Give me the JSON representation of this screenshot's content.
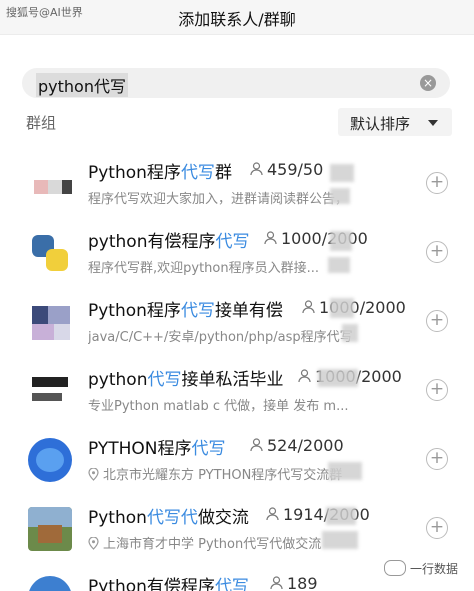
{
  "header": {
    "watermark": "搜狐号@AI世界",
    "title": "添加联系人/群聊"
  },
  "search": {
    "value": "python代写",
    "clear_icon": "clear-icon"
  },
  "filter": {
    "label": "群组",
    "sort_label": "默认排序"
  },
  "groups": [
    {
      "name_prefix": "Python程序",
      "name_highlight": "代写",
      "name_suffix": "群",
      "members": "459/50",
      "desc": "程序代写欢迎大家加入，进群请阅读群公告，"
    },
    {
      "name_prefix": "python有偿程序",
      "name_highlight": "代写",
      "name_suffix": "",
      "members": "1000/2000",
      "desc": "程序代写群,欢迎python程序员入群接..."
    },
    {
      "name_prefix": "Python程序",
      "name_highlight": "代写",
      "name_suffix": "接单有偿",
      "members": "1000/2000",
      "desc": "java/C/C++/安卓/python/php/asp程序代写"
    },
    {
      "name_prefix": "python",
      "name_highlight": "代写",
      "name_suffix": "接单私活毕业",
      "members": "1000/2000",
      "desc": "专业Python matlab c 代做，接单 发布 m..."
    },
    {
      "name_prefix": "PYTHON程序",
      "name_highlight": "代写",
      "name_suffix": "",
      "members": "524/2000",
      "desc": "北京市光耀东方 PYTHON程序代写交流群"
    },
    {
      "name_prefix": "Python",
      "name_highlight": "代写代",
      "name_suffix": "做交流",
      "members": "1914/2000",
      "desc": "上海市育才中学 Python代写代做交流"
    },
    {
      "name_prefix": "Python有偿程序",
      "name_highlight": "代写",
      "name_suffix": "",
      "members": "189",
      "desc": ""
    }
  ],
  "corner_watermark": "一行数据",
  "colors": {
    "highlight": "#3b8be0",
    "muted": "#888888"
  }
}
